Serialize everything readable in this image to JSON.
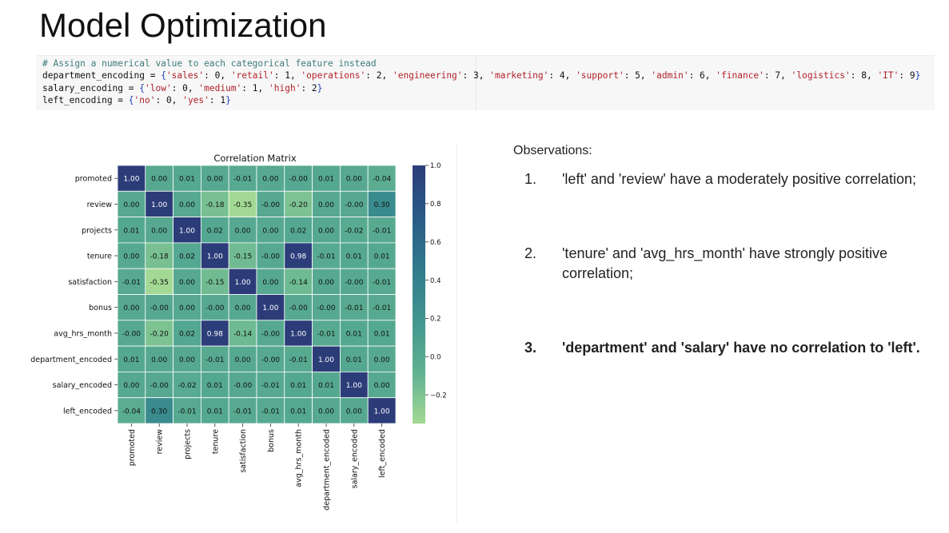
{
  "slide": {
    "title": "Model Optimization"
  },
  "code": {
    "comment": "# Assign a numerical value to each categorical feature instead",
    "lines": [
      "department_encoding = {'sales': 0, 'retail': 1, 'operations': 2, 'engineering': 3, 'marketing': 4, 'support': 5, 'admin': 6, 'finance': 7, 'logistics': 8, 'IT': 9}",
      "salary_encoding = {'low': 0, 'medium': 1, 'high': 2}",
      "left_encoding = {'no': 0, 'yes': 1}"
    ]
  },
  "chart_data": {
    "type": "heatmap",
    "title": "Correlation Matrix",
    "labels": [
      "promoted",
      "review",
      "projects",
      "tenure",
      "satisfaction",
      "bonus",
      "avg_hrs_month",
      "department_encoded",
      "salary_encoded",
      "left_encoded"
    ],
    "matrix": [
      [
        "1.00",
        "0.00",
        "0.01",
        "0.00",
        "-0.01",
        "0.00",
        "-0.00",
        "0.01",
        "0.00",
        "-0.04"
      ],
      [
        "0.00",
        "1.00",
        "0.00",
        "-0.18",
        "-0.35",
        "-0.00",
        "-0.20",
        "0.00",
        "-0.00",
        "0.30"
      ],
      [
        "0.01",
        "0.00",
        "1.00",
        "0.02",
        "0.00",
        "0.00",
        "0.02",
        "0.00",
        "-0.02",
        "-0.01"
      ],
      [
        "0.00",
        "-0.18",
        "0.02",
        "1.00",
        "-0.15",
        "-0.00",
        "0.98",
        "-0.01",
        "0.01",
        "0.01"
      ],
      [
        "-0.01",
        "-0.35",
        "0.00",
        "-0.15",
        "1.00",
        "0.00",
        "-0.14",
        "0.00",
        "-0.00",
        "-0.01"
      ],
      [
        "0.00",
        "-0.00",
        "0.00",
        "-0.00",
        "0.00",
        "1.00",
        "-0.00",
        "-0.00",
        "-0.01",
        "-0.01"
      ],
      [
        "-0.00",
        "-0.20",
        "0.02",
        "0.98",
        "-0.14",
        "-0.00",
        "1.00",
        "-0.01",
        "0.01",
        "0.01"
      ],
      [
        "0.01",
        "0.00",
        "0.00",
        "-0.01",
        "0.00",
        "-0.00",
        "-0.01",
        "1.00",
        "0.01",
        "0.00"
      ],
      [
        "0.00",
        "-0.00",
        "-0.02",
        "0.01",
        "-0.00",
        "-0.01",
        "0.01",
        "0.01",
        "1.00",
        "0.00"
      ],
      [
        "-0.04",
        "0.30",
        "-0.01",
        "0.01",
        "-0.01",
        "-0.01",
        "0.01",
        "0.00",
        "0.00",
        "1.00"
      ]
    ],
    "colorbar": {
      "range": [
        -0.35,
        1.0
      ],
      "ticks": [
        "1.0",
        "0.8",
        "0.6",
        "0.4",
        "0.2",
        "0.0",
        "−0.2"
      ],
      "tick_values": [
        1.0,
        0.8,
        0.6,
        0.4,
        0.2,
        0.0,
        -0.2
      ]
    },
    "colormap": [
      "#a3d994",
      "#5fb191",
      "#41968f",
      "#2f7a8c",
      "#2a5b86",
      "#2c3c79"
    ]
  },
  "observations": {
    "heading": "Observations:",
    "items": [
      {
        "num": "1.",
        "text": "'left' and 'review' have a moderately positive correlation;"
      },
      {
        "num": "2.",
        "text": "'tenure' and 'avg_hrs_month' have strongly positive correlation;"
      },
      {
        "num": "3.",
        "text": "'department' and 'salary' have no correlation to 'left'."
      }
    ]
  }
}
